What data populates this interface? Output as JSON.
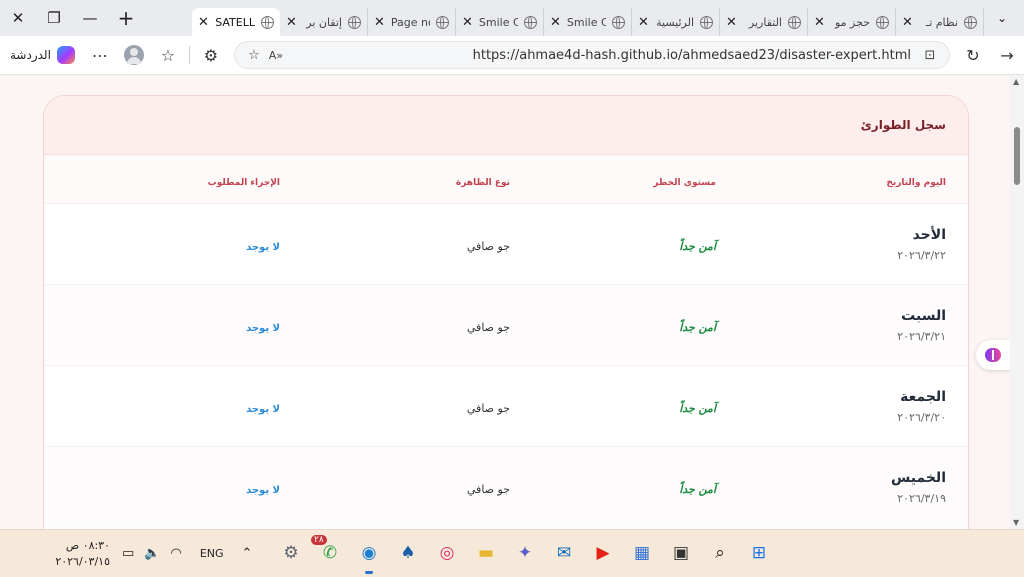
{
  "browser": {
    "tabs": [
      {
        "title": "نظام تـ",
        "active": false
      },
      {
        "title": "حجز مو",
        "active": false
      },
      {
        "title": "التقارير",
        "active": false
      },
      {
        "title": "الرئيسية",
        "active": false
      },
      {
        "title": "Smile C",
        "active": false
      },
      {
        "title": "Smile C",
        "active": false
      },
      {
        "title": "Page no",
        "active": false
      },
      {
        "title": "إتقان بر",
        "active": false
      },
      {
        "title": "SATELL",
        "active": true
      }
    ],
    "chat_label": "الدردشة",
    "url": "https://ahmae4d-hash.github.io/ahmedsaed23/disaster-expert.html"
  },
  "page": {
    "section_title": "سجل الطوارئ",
    "table_headers": {
      "day_date": "اليوم والتاريخ",
      "risk_level": "مستوى الخطر",
      "phenomenon": "نوع الظاهرة",
      "action": "الإجراء المطلوب"
    },
    "rows": [
      {
        "day": "الأحد",
        "date": "٢٠٢٦/٣/٢٢",
        "risk": "آمن جداً",
        "phenomenon": "جو صافي",
        "action": "لا يوجد"
      },
      {
        "day": "السبت",
        "date": "٢٠٢٦/٣/٢١",
        "risk": "آمن جداً",
        "phenomenon": "جو صافي",
        "action": "لا يوجد"
      },
      {
        "day": "الجمعة",
        "date": "٢٠٢٦/٣/٢٠",
        "risk": "آمن جداً",
        "phenomenon": "جو صافي",
        "action": "لا يوجد"
      },
      {
        "day": "الخميس",
        "date": "٢٠٢٦/٣/١٩",
        "risk": "آمن جداً",
        "phenomenon": "جو صافي",
        "action": "لا يوجد"
      }
    ]
  },
  "taskbar": {
    "time": "٠٨:٣٠ ص",
    "date": "٢٠٢٦/٠٣/١٥",
    "language": "ENG",
    "whatsapp_badge": "٢٨"
  }
}
